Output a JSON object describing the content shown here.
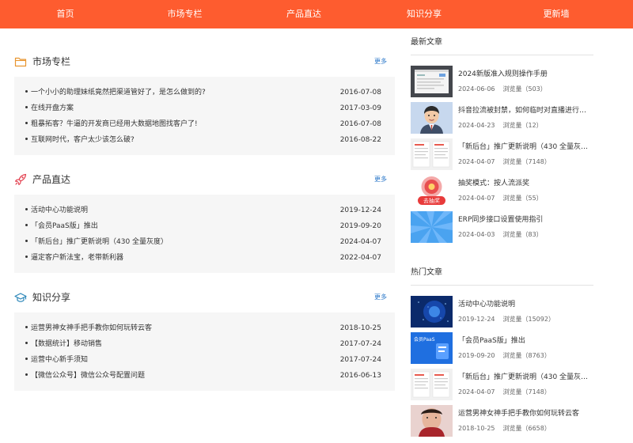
{
  "nav": [
    {
      "label": "首页"
    },
    {
      "label": "市场专栏"
    },
    {
      "label": "产品直达"
    },
    {
      "label": "知识分享"
    },
    {
      "label": "更新墙"
    }
  ],
  "sections": [
    {
      "title": "市场专栏",
      "more": "更多",
      "icon": "folder-icon",
      "items": [
        {
          "title": "一个小小的助理妹纸竟然把渠道管好了，是怎么做到的?",
          "date": "2016-07-08"
        },
        {
          "title": "在线开盘方案",
          "date": "2017-03-09"
        },
        {
          "title": "粗暴拓客？牛逼的开发商已经用大数据地图找客户了!",
          "date": "2016-07-08"
        },
        {
          "title": "互联网时代，客户太少该怎么破?",
          "date": "2016-08-22"
        }
      ]
    },
    {
      "title": "产品直达",
      "more": "更多",
      "icon": "rocket-icon",
      "items": [
        {
          "title": "活动中心功能说明",
          "date": "2019-12-24"
        },
        {
          "title": "「会员PaaS版」推出",
          "date": "2019-09-20"
        },
        {
          "title": "「新后台」推广更新说明（430 全量灰度）",
          "date": "2024-04-07"
        },
        {
          "title": "逼定客户新法宝，老带新利器",
          "date": "2022-04-07"
        }
      ]
    },
    {
      "title": "知识分享",
      "more": "更多",
      "icon": "graduation-cap-icon",
      "items": [
        {
          "title": "运营男神女神手把手教你如何玩转云客",
          "date": "2018-10-25"
        },
        {
          "title": "【数据统计】移动销售",
          "date": "2017-07-24"
        },
        {
          "title": "运营中心新手须知",
          "date": "2017-07-24"
        },
        {
          "title": "【微信公众号】微信公众号配置问题",
          "date": "2016-06-13"
        }
      ]
    }
  ],
  "latest": {
    "title": "最新文章",
    "views_label": "浏览量",
    "items": [
      {
        "title": "2024新版准入规则操作手册",
        "date": "2024-06-06",
        "views": "（503）"
      },
      {
        "title": "抖音拉流被封禁，如何临时对直播进行…",
        "date": "2024-04-23",
        "views": "（12）"
      },
      {
        "title": "「新后台」推广更新说明（430 全量灰…",
        "date": "2024-04-07",
        "views": "（7148）"
      },
      {
        "title": "抽奖模式：按人流派奖",
        "date": "2024-04-07",
        "views": "（55）",
        "thumb_text": "去抽奖"
      },
      {
        "title": "ERP同步接口设置使用指引",
        "date": "2024-04-03",
        "views": "（83）"
      }
    ]
  },
  "hot": {
    "title": "热门文章",
    "views_label": "浏览量",
    "items": [
      {
        "title": "活动中心功能说明",
        "date": "2019-12-24",
        "views": "（15092）"
      },
      {
        "title": "「会员PaaS版」推出",
        "date": "2019-09-20",
        "views": "（8763）",
        "thumb_text": "会员PaaS"
      },
      {
        "title": "「新后台」推广更新说明（430 全量灰…",
        "date": "2024-04-07",
        "views": "（7148）"
      },
      {
        "title": "运营男神女神手把手教你如何玩转云客",
        "date": "2018-10-25",
        "views": "（6658）"
      }
    ]
  },
  "colors": {
    "accent": "#fe5c2f",
    "link": "#2a77c9",
    "panel": "#f6f6f6"
  }
}
